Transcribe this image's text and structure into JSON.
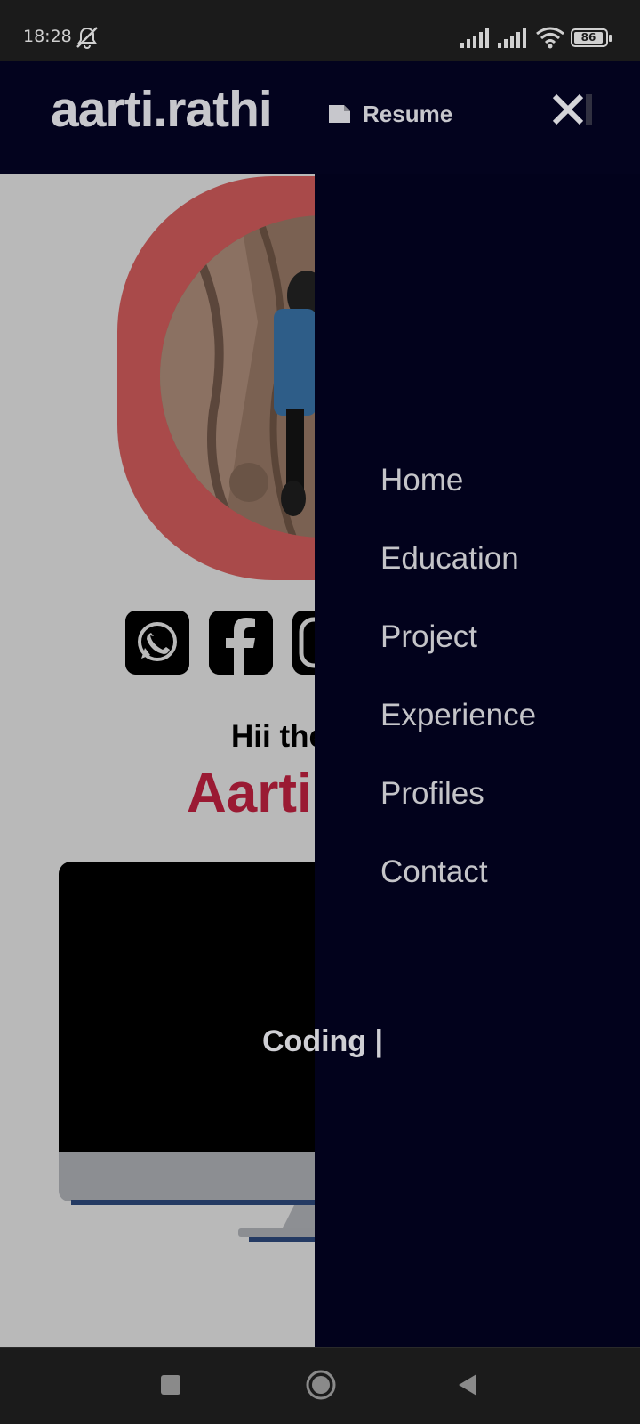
{
  "status_bar": {
    "time": "18:28",
    "battery_level": "86",
    "icons": [
      "mute-notifications-icon",
      "signal-icon",
      "signal-icon",
      "wifi-icon",
      "battery-icon"
    ]
  },
  "header": {
    "brand": "aarti.rathi",
    "resume_label": "Resume",
    "resume_icon": "file-icon",
    "close_icon": "close-icon"
  },
  "page": {
    "social_icons": [
      "whatsapp-icon",
      "facebook-icon",
      "instagram-icon"
    ],
    "greeting": "Hii the",
    "name": "Aarti",
    "typing_text": "Coding |"
  },
  "drawer": {
    "items": [
      {
        "label": "Home"
      },
      {
        "label": "Education"
      },
      {
        "label": "Project"
      },
      {
        "label": "Experience"
      },
      {
        "label": "Profiles"
      },
      {
        "label": "Contact"
      }
    ]
  },
  "system_nav": {
    "icons": [
      "recents-icon",
      "home-icon",
      "back-icon"
    ]
  },
  "colors": {
    "header_bg": "#03031e",
    "drawer_bg": "#02021c",
    "accent": "#9a1a33",
    "avatar_ring": "#a94a4a"
  }
}
